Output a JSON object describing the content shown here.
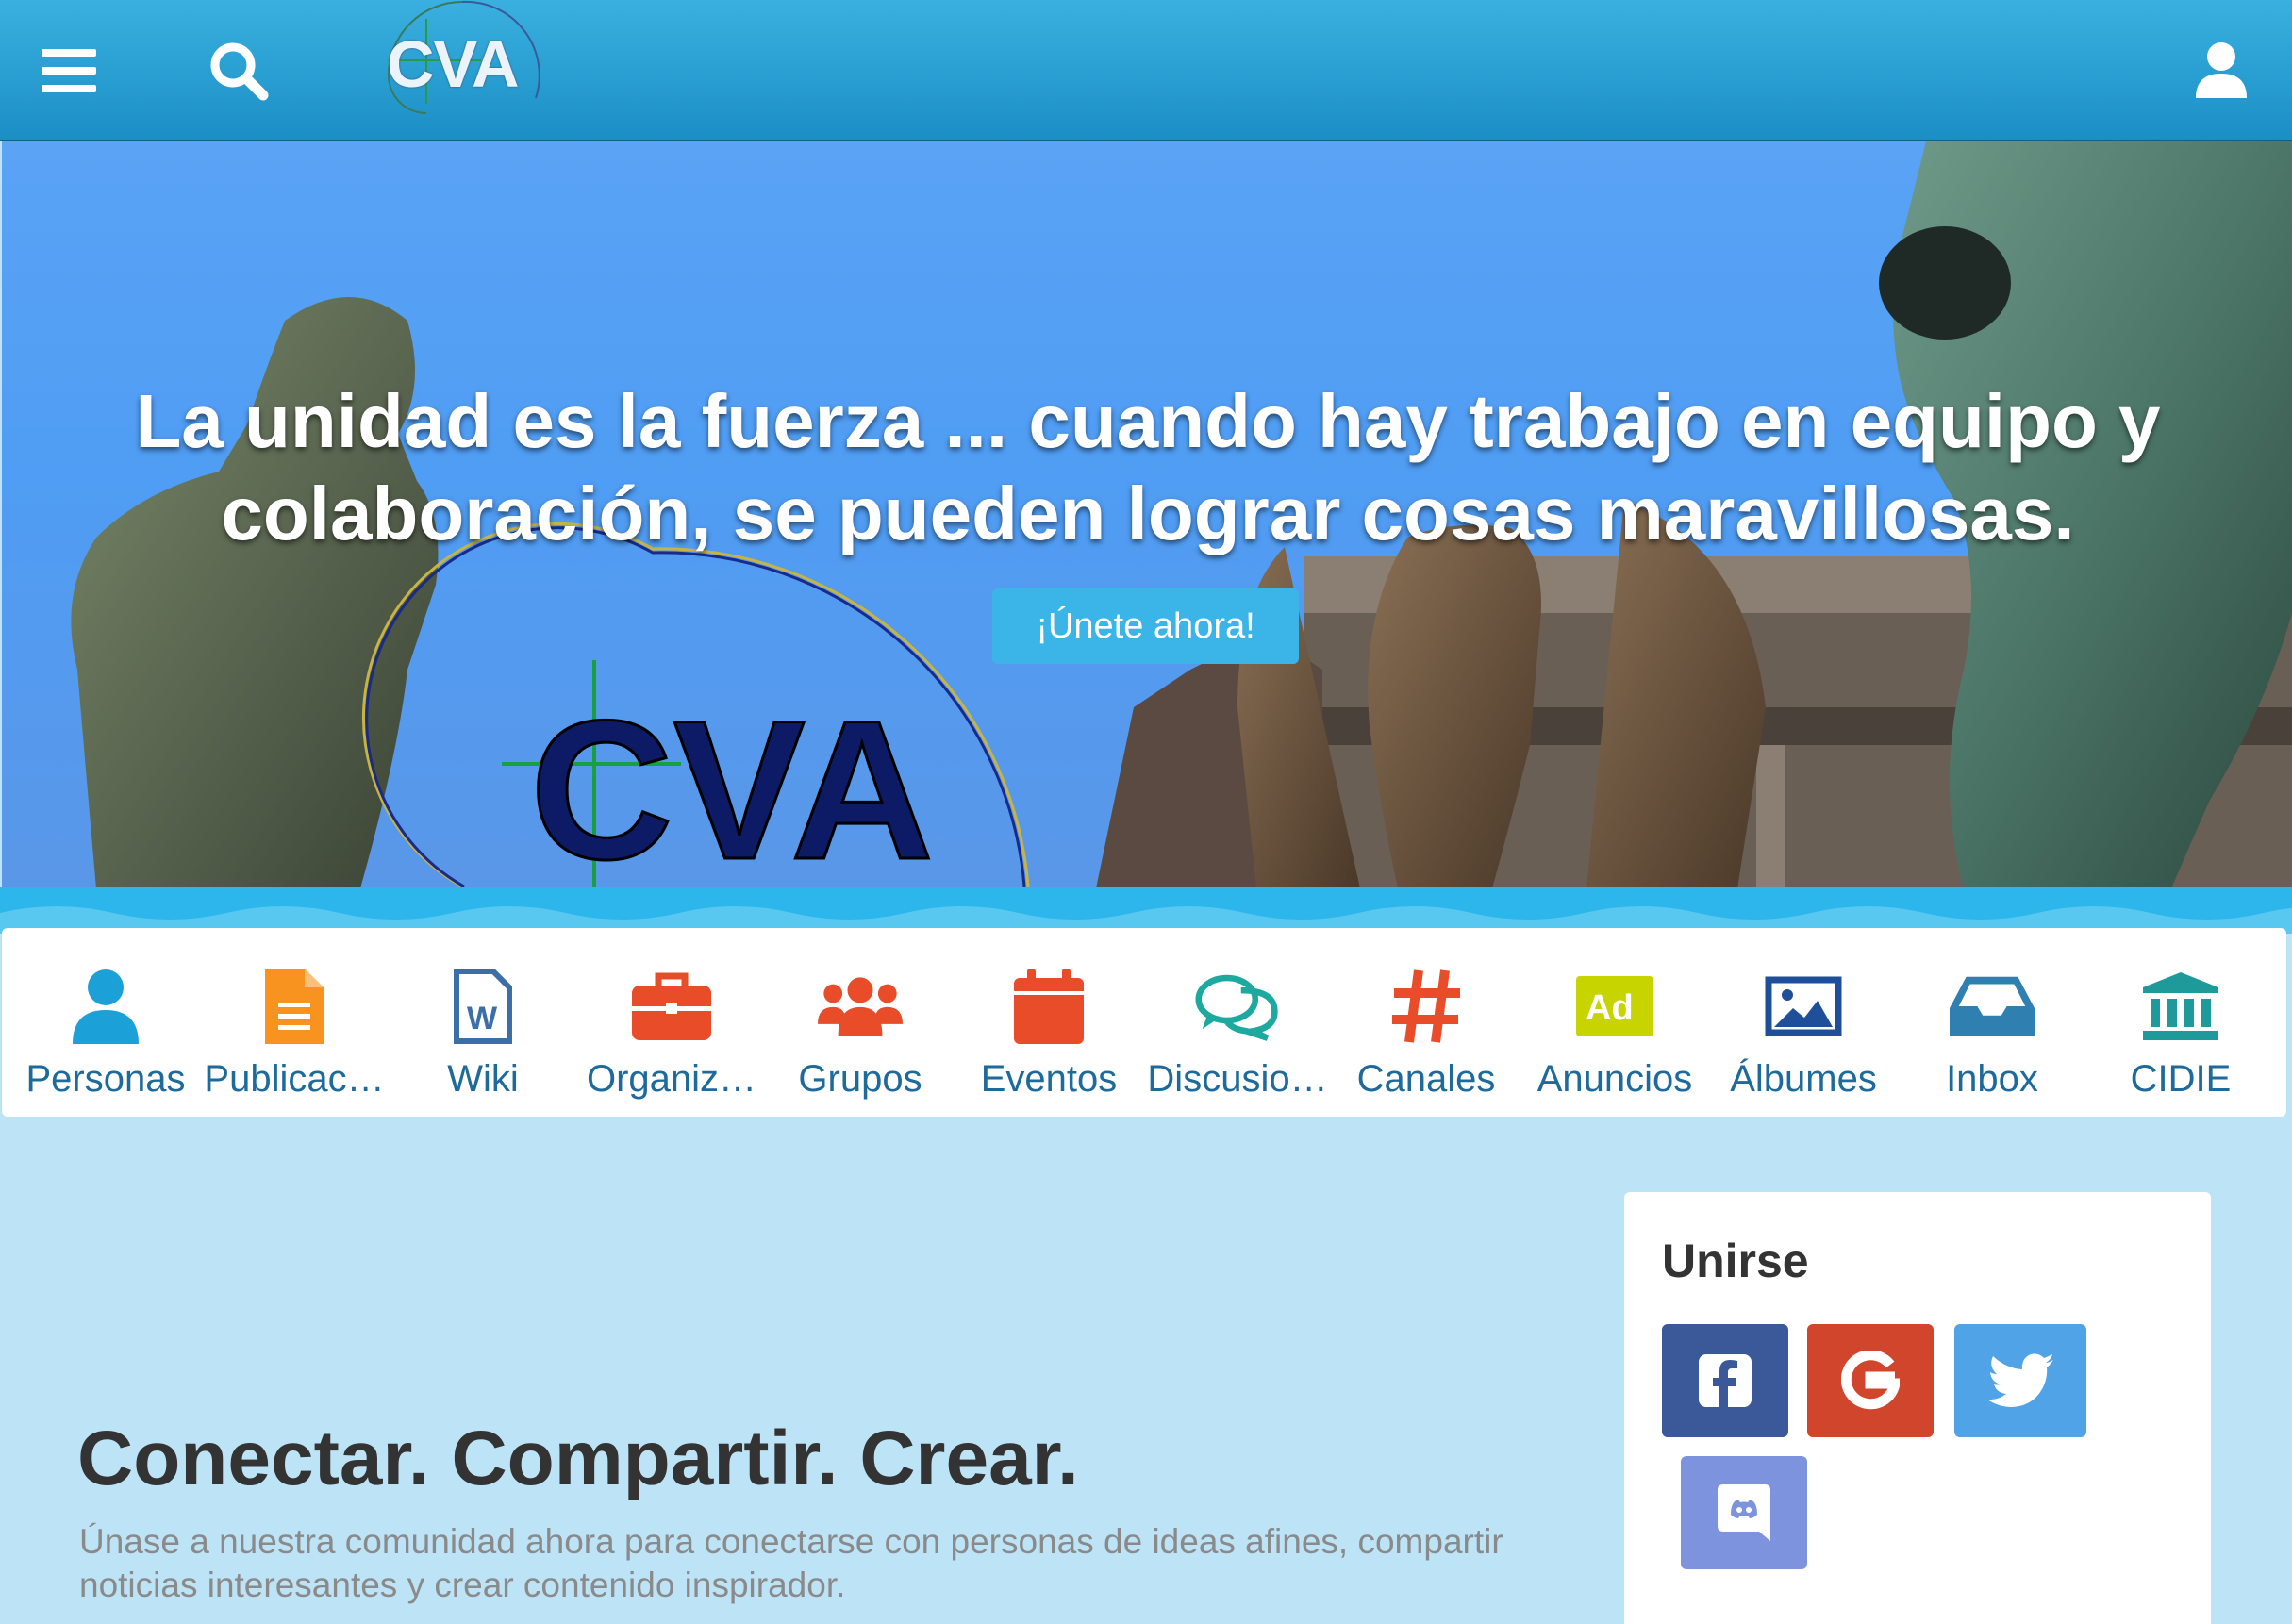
{
  "header": {
    "logo_text": "CVA",
    "icons": [
      "menu-icon",
      "search-icon",
      "user-icon"
    ]
  },
  "hero": {
    "title": "La unidad es la fuerza ... cuando hay trabajo en equipo y colaboración, se pueden lograr cosas maravillosas.",
    "cta": "¡Únete ahora!",
    "logo_text": "CVA"
  },
  "nav": {
    "items": [
      {
        "label": "Personas",
        "icon": "person-icon",
        "color": "#1ba1d8"
      },
      {
        "label": "Publicac…",
        "icon": "document-icon",
        "color": "#f7931e"
      },
      {
        "label": "Wiki",
        "icon": "word-file-icon",
        "color": "#3c6fa8"
      },
      {
        "label": "Organiz…",
        "icon": "briefcase-icon",
        "color": "#e84c28"
      },
      {
        "label": "Grupos",
        "icon": "users-icon",
        "color": "#e84c28"
      },
      {
        "label": "Eventos",
        "icon": "calendar-icon",
        "color": "#e84c28"
      },
      {
        "label": "Discusio…",
        "icon": "chat-bubbles-icon",
        "color": "#1ea9a0"
      },
      {
        "label": "Canales",
        "icon": "hashtag-icon",
        "color": "#e84c28"
      },
      {
        "label": "Anuncios",
        "icon": "ad-icon",
        "color": "#c8d400"
      },
      {
        "label": "Álbumes",
        "icon": "image-icon",
        "color": "#1f4f9a"
      },
      {
        "label": "Inbox",
        "icon": "inbox-icon",
        "color": "#2f7fb0"
      },
      {
        "label": "CIDIE",
        "icon": "institution-icon",
        "color": "#1e9a9a"
      }
    ]
  },
  "main": {
    "tagline": "Conectar. Compartir. Crear.",
    "subtitle": "Únase a nuestra comunidad ahora para conectarse con personas de ideas afines, compartir noticias interesantes y crear contenido inspirador."
  },
  "join_card": {
    "title": "Unirse",
    "buttons": [
      {
        "icon": "facebook-icon",
        "color": "#3b5998"
      },
      {
        "icon": "google-icon",
        "color": "#d0452c"
      },
      {
        "icon": "twitter-icon",
        "color": "#4fa3e6"
      },
      {
        "icon": "discord-icon",
        "color": "#7289da"
      }
    ]
  }
}
